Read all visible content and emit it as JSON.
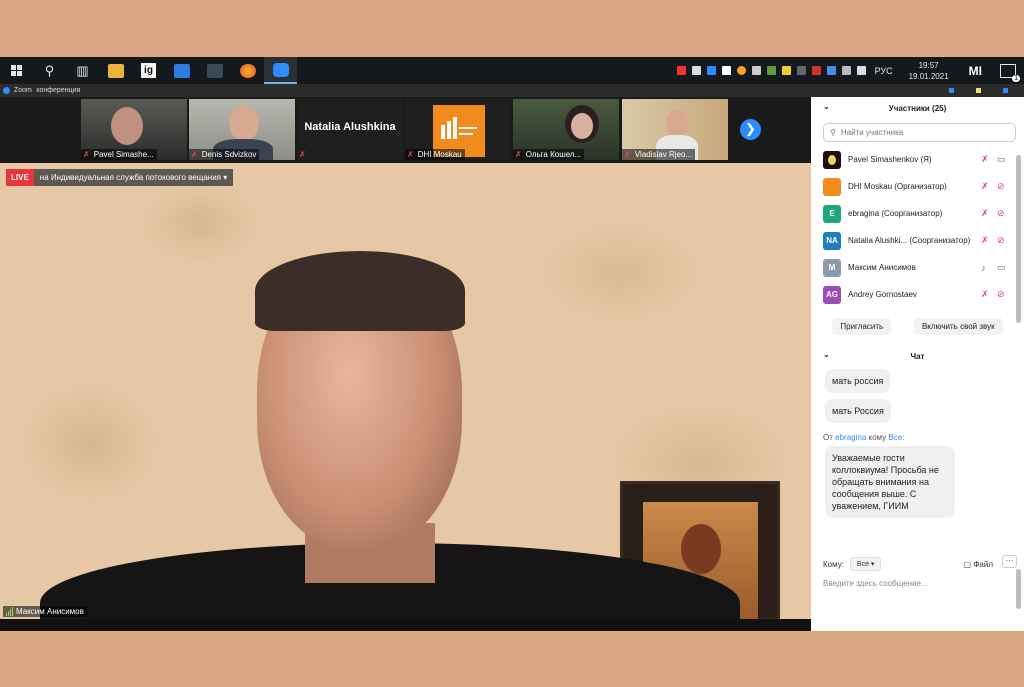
{
  "taskbar": {
    "ig_label": "ig",
    "lang": "РУС",
    "time": "19:57",
    "date": "19.01.2021",
    "mi_label": "MI",
    "notif_count": "1"
  },
  "zoom_title": {
    "app": "Zoom",
    "subtitle": "конференция"
  },
  "strip": {
    "tiles": [
      {
        "name": "Pavel Simashe..."
      },
      {
        "name": "Denis Sdvizkov"
      },
      {
        "bigname": "Natalia Alushkina"
      },
      {
        "name": "DHI Moskau"
      },
      {
        "name": "Ольга Кошел..."
      },
      {
        "name": "Vladislav Rjeo..."
      }
    ],
    "next_label": "❯"
  },
  "video": {
    "live_badge": "LIVE",
    "live_text": "на Индивидуальная служба потокового вещания",
    "speaker_name": "Максим Анисимов"
  },
  "participants": {
    "header": "Участники (25)",
    "search_placeholder": "Найти участника",
    "list": [
      {
        "initials": "",
        "name": "Pavel Simashenkov (Я)",
        "color": "#111111"
      },
      {
        "initials": "",
        "name": "DHI Moskau (Организатор)",
        "color": "#f08b1c"
      },
      {
        "initials": "E",
        "name": "ebragina (Соорганизатор)",
        "color": "#1fa67a"
      },
      {
        "initials": "NA",
        "name": "Natalia Alushki... (Соорганизатор)",
        "color": "#1f7fbf"
      },
      {
        "initials": "M",
        "name": "Максим Анисимов",
        "color": "#8a9aa8"
      },
      {
        "initials": "AG",
        "name": "Andrey Gornostaev",
        "color": "#a04ab8"
      }
    ],
    "invite_label": "Пригласить",
    "unmute_label": "Включить свой звук"
  },
  "chat": {
    "header": "Чат",
    "messages": [
      "мать россия",
      "мать Россия"
    ],
    "from_prefix": "От",
    "from_user": "ebragina",
    "from_suffix": "кому",
    "from_target": "Все:",
    "long_message": "Уважаемые гости коллоквиума! Просьба не обращать внимания на сообщения выше. С уважением, ГИИМ",
    "to_label": "Кому:",
    "to_value": "Все",
    "file_label": "Файл",
    "more_label": "···",
    "input_placeholder": "Введите здесь сообщение..."
  }
}
